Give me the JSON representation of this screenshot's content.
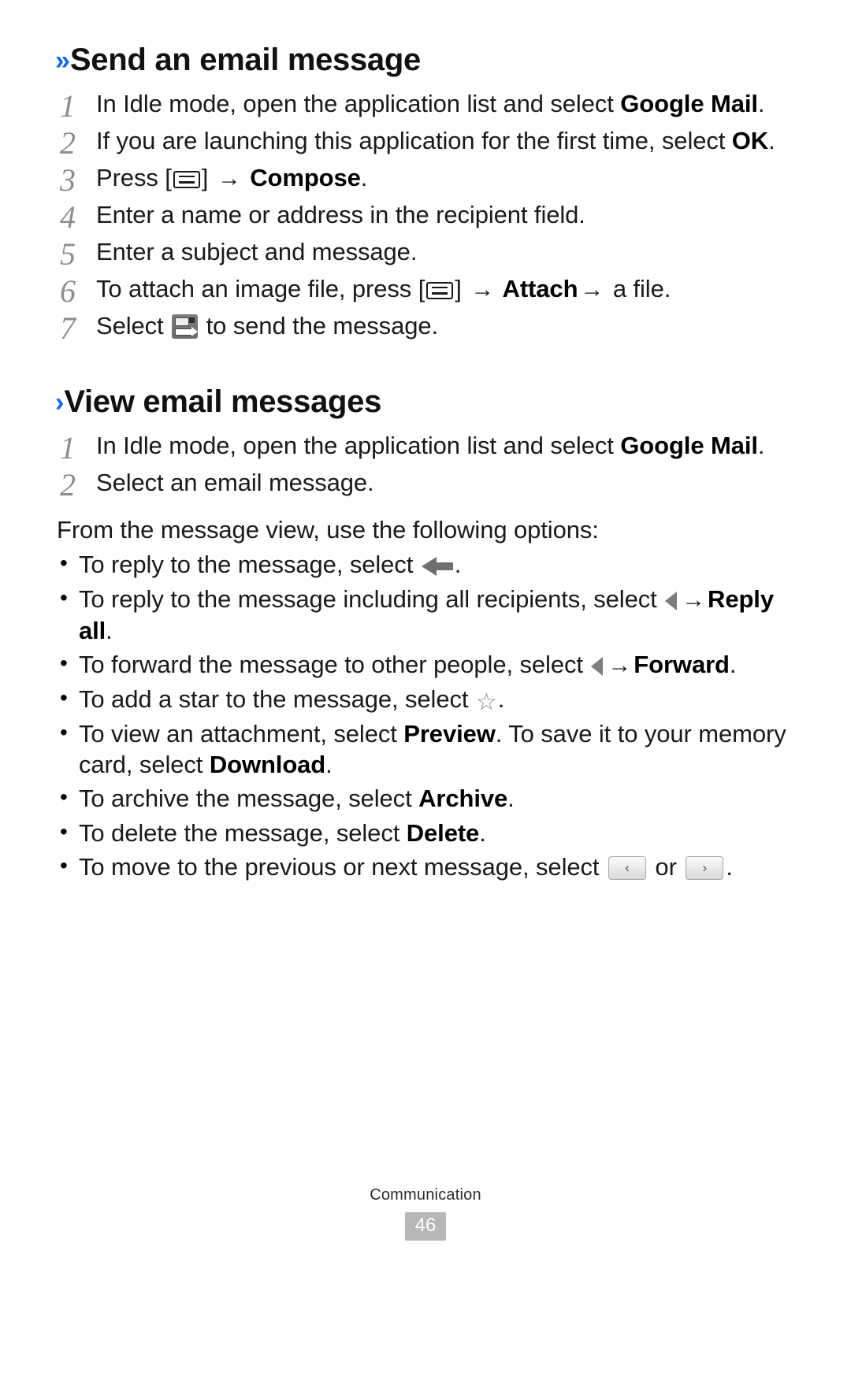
{
  "page": {
    "footer_label": "Communication",
    "page_number": "46",
    "accent_color": "#1368e8",
    "number_color": "#8d8d8d",
    "page_box_color": "#b7b7b7"
  },
  "sections": [
    {
      "chevron": "»",
      "title": "Send an email message",
      "steps": [
        {
          "num": "1",
          "pre": "In Idle mode, open the application list and select ",
          "bold": "Google Mail",
          "post": "."
        },
        {
          "num": "2",
          "pre": "If you are launching this application for the first time, select ",
          "bold": "OK",
          "post": "."
        },
        {
          "num": "3",
          "pre": "Press [",
          "icon": "menu-key-icon",
          "mid": "] ",
          "arrow": "→",
          "bold": " Compose",
          "post": "."
        },
        {
          "num": "4",
          "pre": "Enter a name or address in the recipient field.",
          "bold": "",
          "post": ""
        },
        {
          "num": "5",
          "pre": "Enter a subject and message.",
          "bold": "",
          "post": ""
        },
        {
          "num": "6",
          "pre": "To attach an image file, press [",
          "icon": "menu-key-icon",
          "mid": "] ",
          "arrow": "→",
          "bold": " Attach",
          "arrow2": "→",
          "post": " a file."
        },
        {
          "num": "7",
          "pre": "Select ",
          "icon": "send-icon",
          "post": " to send the message."
        }
      ]
    },
    {
      "chevron": "›",
      "title": "View email messages",
      "steps": [
        {
          "num": "1",
          "pre": "In Idle mode, open the application list and select ",
          "bold": "Google Mail",
          "post": "."
        },
        {
          "num": "2",
          "pre": "Select an email message.",
          "bold": "",
          "post": ""
        }
      ],
      "lead": "From the message view, use the following options:",
      "bullets": [
        {
          "dot": "•",
          "pre": "To reply to the message, select ",
          "icon": "reply-arrow-icon",
          "post": "."
        },
        {
          "dot": "•",
          "pre": "To reply to the message including all recipients, select ",
          "icon": "triangle-left-icon",
          "arrow": "→",
          "bold": "Reply all",
          "post": "."
        },
        {
          "dot": "•",
          "pre": "To forward the message to other people, select ",
          "icon": "triangle-left-icon",
          "arrow": "→",
          "bold": "Forward",
          "post": "."
        },
        {
          "dot": "•",
          "pre": "To add a star to the message, select ",
          "icon": "star-icon",
          "post": "."
        },
        {
          "dot": "•",
          "pre": "To view an attachment, select ",
          "bold": "Preview",
          "mid": ". To save it to your memory card, select ",
          "bold2": "Download",
          "post": "."
        },
        {
          "dot": "•",
          "pre": "To archive the message, select ",
          "bold": "Archive",
          "post": "."
        },
        {
          "dot": "•",
          "pre": "To delete the message, select ",
          "bold": "Delete",
          "post": "."
        },
        {
          "dot": "•",
          "pre": "To move to the previous or next message, select ",
          "icon": "prev-button-icon",
          "mid": " or ",
          "icon2": "next-button-icon",
          "post": "."
        }
      ]
    }
  ],
  "icons": {
    "prev_glyph": "‹",
    "next_glyph": "›",
    "star_glyph": "☆"
  }
}
